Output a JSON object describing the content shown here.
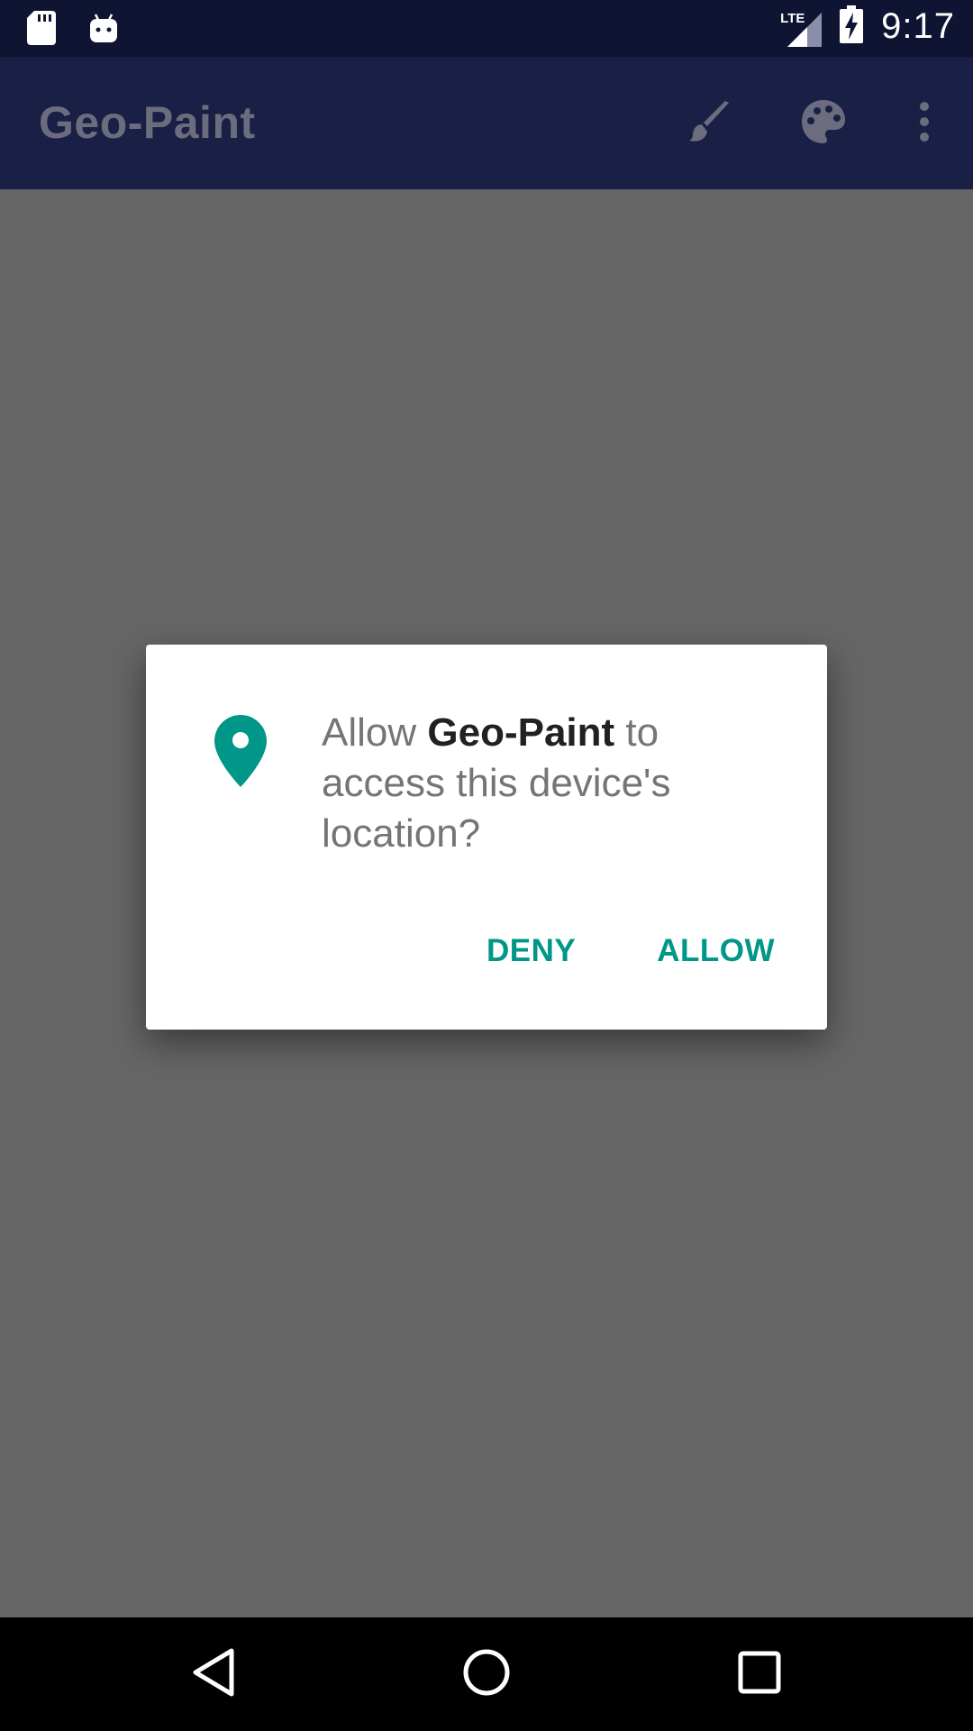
{
  "status_bar": {
    "time": "9:17",
    "network": "LTE",
    "icons": [
      "sd-card-icon",
      "android-icon",
      "signal-icon",
      "battery-charging-icon"
    ]
  },
  "app_bar": {
    "title": "Geo-Paint",
    "actions": [
      "brush-icon",
      "palette-icon",
      "more-vert-icon"
    ]
  },
  "dialog": {
    "icon": "location-pin-icon",
    "message_prefix": "Allow ",
    "app_name": "Geo-Paint",
    "message_suffix": " to access this device's location?",
    "deny_label": "DENY",
    "allow_label": "ALLOW",
    "accent_color": "#009688"
  },
  "nav_bar": {
    "buttons": [
      "back-icon",
      "home-icon",
      "recents-icon"
    ]
  },
  "colors": {
    "status_bar": "#0f1433",
    "app_bar": "#1a1f45",
    "scrim": "#666666",
    "dialog_bg": "#ffffff"
  }
}
